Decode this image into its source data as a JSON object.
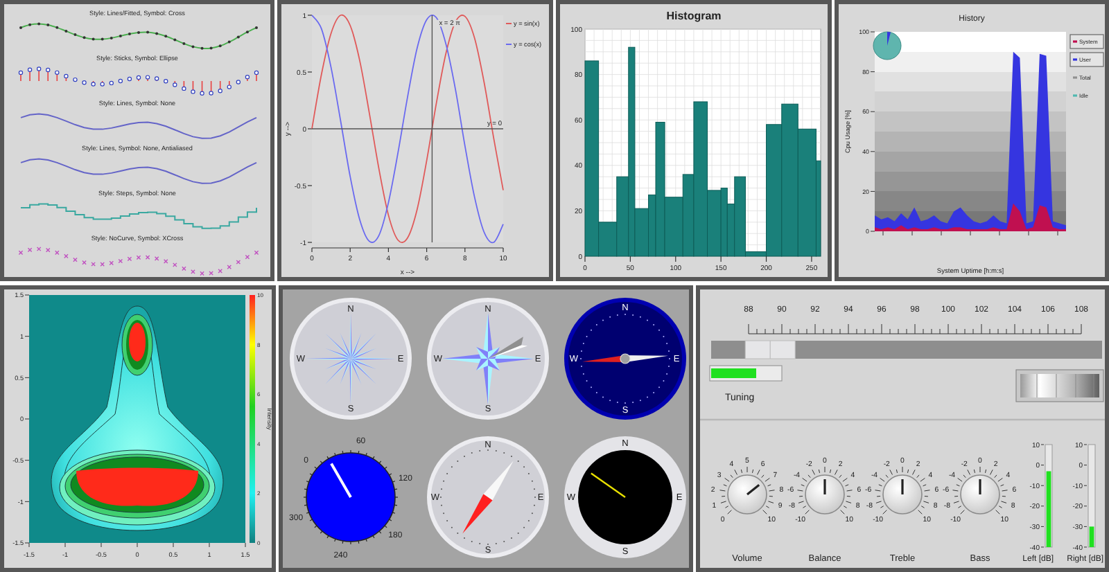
{
  "curve_styles": {
    "curves": [
      {
        "label": "Style: Lines/Fitted, Symbol: Cross",
        "kind": "fitted"
      },
      {
        "label": "Style: Sticks, Symbol: Ellipse",
        "kind": "sticks"
      },
      {
        "label": "Style: Lines, Symbol: None",
        "kind": "lines"
      },
      {
        "label": "Style: Lines, Symbol: None, Antialiased",
        "kind": "lines"
      },
      {
        "label": "Style: Steps, Symbol: None",
        "kind": "steps"
      },
      {
        "label": "Style: NoCurve, Symbol: XCross",
        "kind": "xcross"
      }
    ]
  },
  "sine_plot": {
    "chart_data": {
      "type": "line",
      "xlabel": "x -->",
      "ylabel": "y -->",
      "x": [
        0,
        0.5,
        1,
        1.5,
        2,
        2.5,
        3,
        3.5,
        4,
        4.5,
        5,
        5.5,
        6,
        6.5,
        7,
        7.5,
        8,
        8.5,
        9,
        9.5,
        10
      ],
      "series": [
        {
          "name": "y = sin(x)",
          "color": "#e05a5a",
          "values": [
            0,
            0.48,
            0.84,
            1.0,
            0.91,
            0.6,
            0.14,
            -0.35,
            -0.76,
            -0.98,
            -0.96,
            -0.71,
            -0.28,
            0.22,
            0.66,
            0.94,
            0.99,
            0.8,
            0.41,
            -0.08,
            -0.54
          ]
        },
        {
          "name": "y = cos(x)",
          "color": "#6a6af0",
          "values": [
            1,
            0.88,
            0.54,
            0.07,
            -0.42,
            -0.8,
            -0.99,
            -0.94,
            -0.65,
            -0.21,
            0.28,
            0.71,
            0.96,
            0.98,
            0.75,
            0.35,
            -0.15,
            -0.6,
            -0.91,
            -1.0,
            -0.84
          ]
        }
      ],
      "xlim": [
        0,
        10
      ],
      "ylim": [
        -1,
        1
      ],
      "xticks": [
        0,
        2,
        4,
        6,
        8,
        10
      ],
      "yticks": [
        -1,
        -0.5,
        0,
        0.5,
        1
      ],
      "ref_lines": [
        {
          "axis": "x",
          "value": 6.2832
        },
        {
          "axis": "y",
          "value": 0
        }
      ],
      "legend": "right"
    },
    "marker_labels": [
      "x = 2 π",
      "y = 0"
    ]
  },
  "histogram": {
    "chart_data": {
      "type": "bar",
      "title": "Histogram",
      "x": [
        7.5,
        25,
        41.5,
        51.5,
        62.5,
        74,
        83,
        98,
        114,
        127.5,
        142.5,
        153.5,
        161,
        171,
        188.5,
        208.5,
        226,
        245,
        257.5
      ],
      "values": [
        86,
        15,
        35,
        92,
        21,
        27,
        59,
        26,
        36,
        68,
        29,
        30,
        23,
        35,
        2,
        58,
        67,
        56,
        42
      ],
      "xlim": [
        0,
        260
      ],
      "ylim": [
        0,
        100
      ],
      "xticks": [
        0,
        50,
        100,
        150,
        200,
        250
      ],
      "yticks": [
        0,
        20,
        40,
        60,
        80,
        100
      ],
      "grid": true
    }
  },
  "history": {
    "chart_data": {
      "type": "area",
      "title": "History",
      "xlabel": "System Uptime [h:m:s]",
      "ylabel": "Cpu Usage [%]",
      "series": [
        {
          "name": "System",
          "color": "#c01050",
          "values": [
            2,
            1,
            2,
            1,
            3,
            1,
            2,
            1,
            1,
            2,
            1,
            1,
            2,
            2,
            1,
            1,
            1,
            1,
            2,
            1,
            1,
            14,
            10,
            1,
            2,
            13,
            12,
            2,
            1,
            1
          ]
        },
        {
          "name": "User",
          "color": "#3535e0",
          "values": [
            8,
            6,
            7,
            5,
            9,
            6,
            12,
            5,
            6,
            8,
            5,
            4,
            10,
            12,
            8,
            5,
            4,
            5,
            8,
            5,
            4,
            90,
            87,
            4,
            5,
            89,
            88,
            5,
            4,
            3
          ]
        },
        {
          "name": "Total",
          "color": "#909090"
        },
        {
          "name": "Idle",
          "color": "#50b8b0"
        }
      ],
      "ylim": [
        0,
        100
      ],
      "yticks": [
        0,
        20,
        40,
        60,
        80,
        100
      ],
      "legend": "right"
    },
    "legend": [
      {
        "checked": true
      },
      {
        "checked": true
      },
      {
        "checked": false
      },
      {
        "checked": false
      }
    ]
  },
  "spectrogram": {
    "yticks": [
      "1.5",
      "1",
      "0.5",
      "0",
      "-0.5",
      "-1",
      "-1.5"
    ],
    "xticks": [
      "-1.5",
      "-1",
      "-0.5",
      "0",
      "0.5",
      "1",
      "1.5"
    ],
    "colorbar": {
      "ticks": [
        "10",
        "8",
        "6",
        "4",
        "2",
        "0"
      ],
      "label": "Intensity"
    }
  },
  "compasses": [
    {
      "kind": "rose16",
      "labels": [
        "N",
        "E",
        "S",
        "W"
      ]
    },
    {
      "kind": "rose4",
      "labels": [
        "N",
        "E",
        "S",
        "W"
      ]
    },
    {
      "kind": "navy",
      "labels": [
        "N",
        "E",
        "S",
        "W"
      ]
    },
    {
      "kind": "scale",
      "labels": [
        "0",
        "60",
        "120",
        "180",
        "240",
        "300"
      ]
    },
    {
      "kind": "needle",
      "labels": [
        "N",
        "E",
        "S",
        "W"
      ]
    },
    {
      "kind": "black",
      "labels": [
        "N",
        "E",
        "S",
        "W"
      ]
    }
  ],
  "radio": {
    "scale": [
      "88",
      "90",
      "92",
      "94",
      "96",
      "98",
      "100",
      "102",
      "104",
      "106",
      "108"
    ],
    "slider": {
      "level": 0.1
    },
    "tuning": {
      "label": "Tuning",
      "level": 0.65
    },
    "knobs": [
      {
        "label": "Volume",
        "level": 0.69,
        "scale": [
          "0",
          "1",
          "2",
          "3",
          "4",
          "5",
          "6",
          "7",
          "8",
          "9",
          "10"
        ]
      },
      {
        "label": "Balance",
        "level": 0.5,
        "scale": [
          "-10",
          "-8",
          "-6",
          "-4",
          "-2",
          "0",
          "2",
          "4",
          "6",
          "8",
          "10"
        ]
      },
      {
        "label": "Treble",
        "level": 0.5,
        "scale": [
          "-10",
          "-8",
          "-6",
          "-4",
          "-2",
          "0",
          "2",
          "4",
          "6",
          "8",
          "10"
        ]
      },
      {
        "label": "Bass",
        "level": 0.5,
        "scale": [
          "-10",
          "-8",
          "-6",
          "-4",
          "-2",
          "0",
          "2",
          "4",
          "6",
          "8",
          "10"
        ]
      }
    ],
    "meters": [
      {
        "label": "Left [dB]",
        "level": 0.74,
        "scale": [
          "10",
          "0",
          "-10",
          "-20",
          "-30",
          "-40"
        ]
      },
      {
        "label": "Right [dB]",
        "level": 0.2,
        "scale": [
          "10",
          "0",
          "-10",
          "-20",
          "-30",
          "-40"
        ]
      }
    ]
  }
}
